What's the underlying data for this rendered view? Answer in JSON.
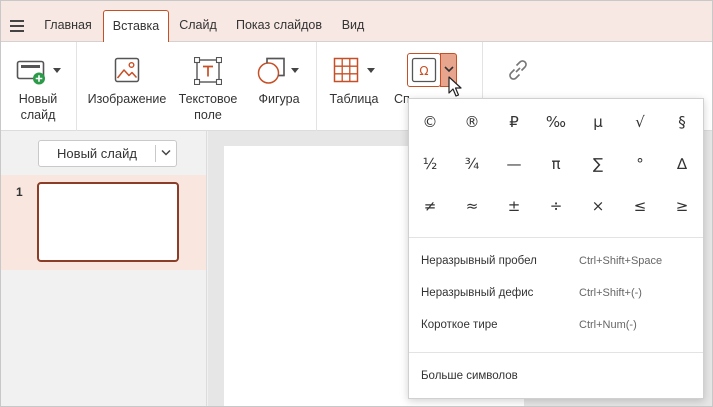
{
  "tabs": [
    {
      "label": "Главная",
      "active": false
    },
    {
      "label": "Вставка",
      "active": true
    },
    {
      "label": "Слайд",
      "active": false
    },
    {
      "label": "Показ слайдов",
      "active": false
    },
    {
      "label": "Вид",
      "active": false
    }
  ],
  "toolbar": {
    "new_slide_line1": "Новый",
    "new_slide_line2": "слайд",
    "image": "Изображение",
    "textbox_line1": "Текстовое",
    "textbox_line2": "поле",
    "shape": "Фигура",
    "table": "Таблица",
    "special_char_partial": "Сп",
    "accent_color": "#c74f26"
  },
  "left_panel": {
    "new_slide_button": "Новый слайд",
    "slide_number": "1"
  },
  "dropdown": {
    "symbols_row1": [
      "©",
      "®",
      "₽",
      "‰",
      "µ",
      "√",
      "§"
    ],
    "symbols_row2": [
      "½",
      "¾",
      "—",
      "π",
      "∑",
      "°",
      "∆"
    ],
    "symbols_row3": [
      "≠",
      "≈",
      "±",
      "÷",
      "×",
      "≤",
      "≥"
    ],
    "items": [
      {
        "name": "Неразрывный пробел",
        "shortcut": "Ctrl+Shift+Space"
      },
      {
        "name": "Неразрывный дефис",
        "shortcut": "Ctrl+Shift+(-)"
      },
      {
        "name": "Короткое тире",
        "shortcut": "Ctrl+Num(-)"
      }
    ],
    "more_symbols": "Больше символов"
  }
}
